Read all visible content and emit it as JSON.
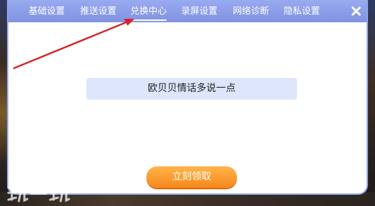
{
  "tabs": [
    {
      "label": "基础设置"
    },
    {
      "label": "推送设置"
    },
    {
      "label": "兑换中心"
    },
    {
      "label": "录屏设置"
    },
    {
      "label": "网络诊断"
    },
    {
      "label": "隐私设置"
    }
  ],
  "active_tab": "兑换中心",
  "close_icon": "close-icon",
  "message": "欧贝贝情话多说一点",
  "claim_button_label": "立刻领取",
  "watermark_text": "玩一玩",
  "colors": {
    "tabbar": "#8a9ce8",
    "message_bg": "#dde6fb",
    "claim_button": "#f6881b",
    "annotation_arrow": "#d4232a"
  }
}
